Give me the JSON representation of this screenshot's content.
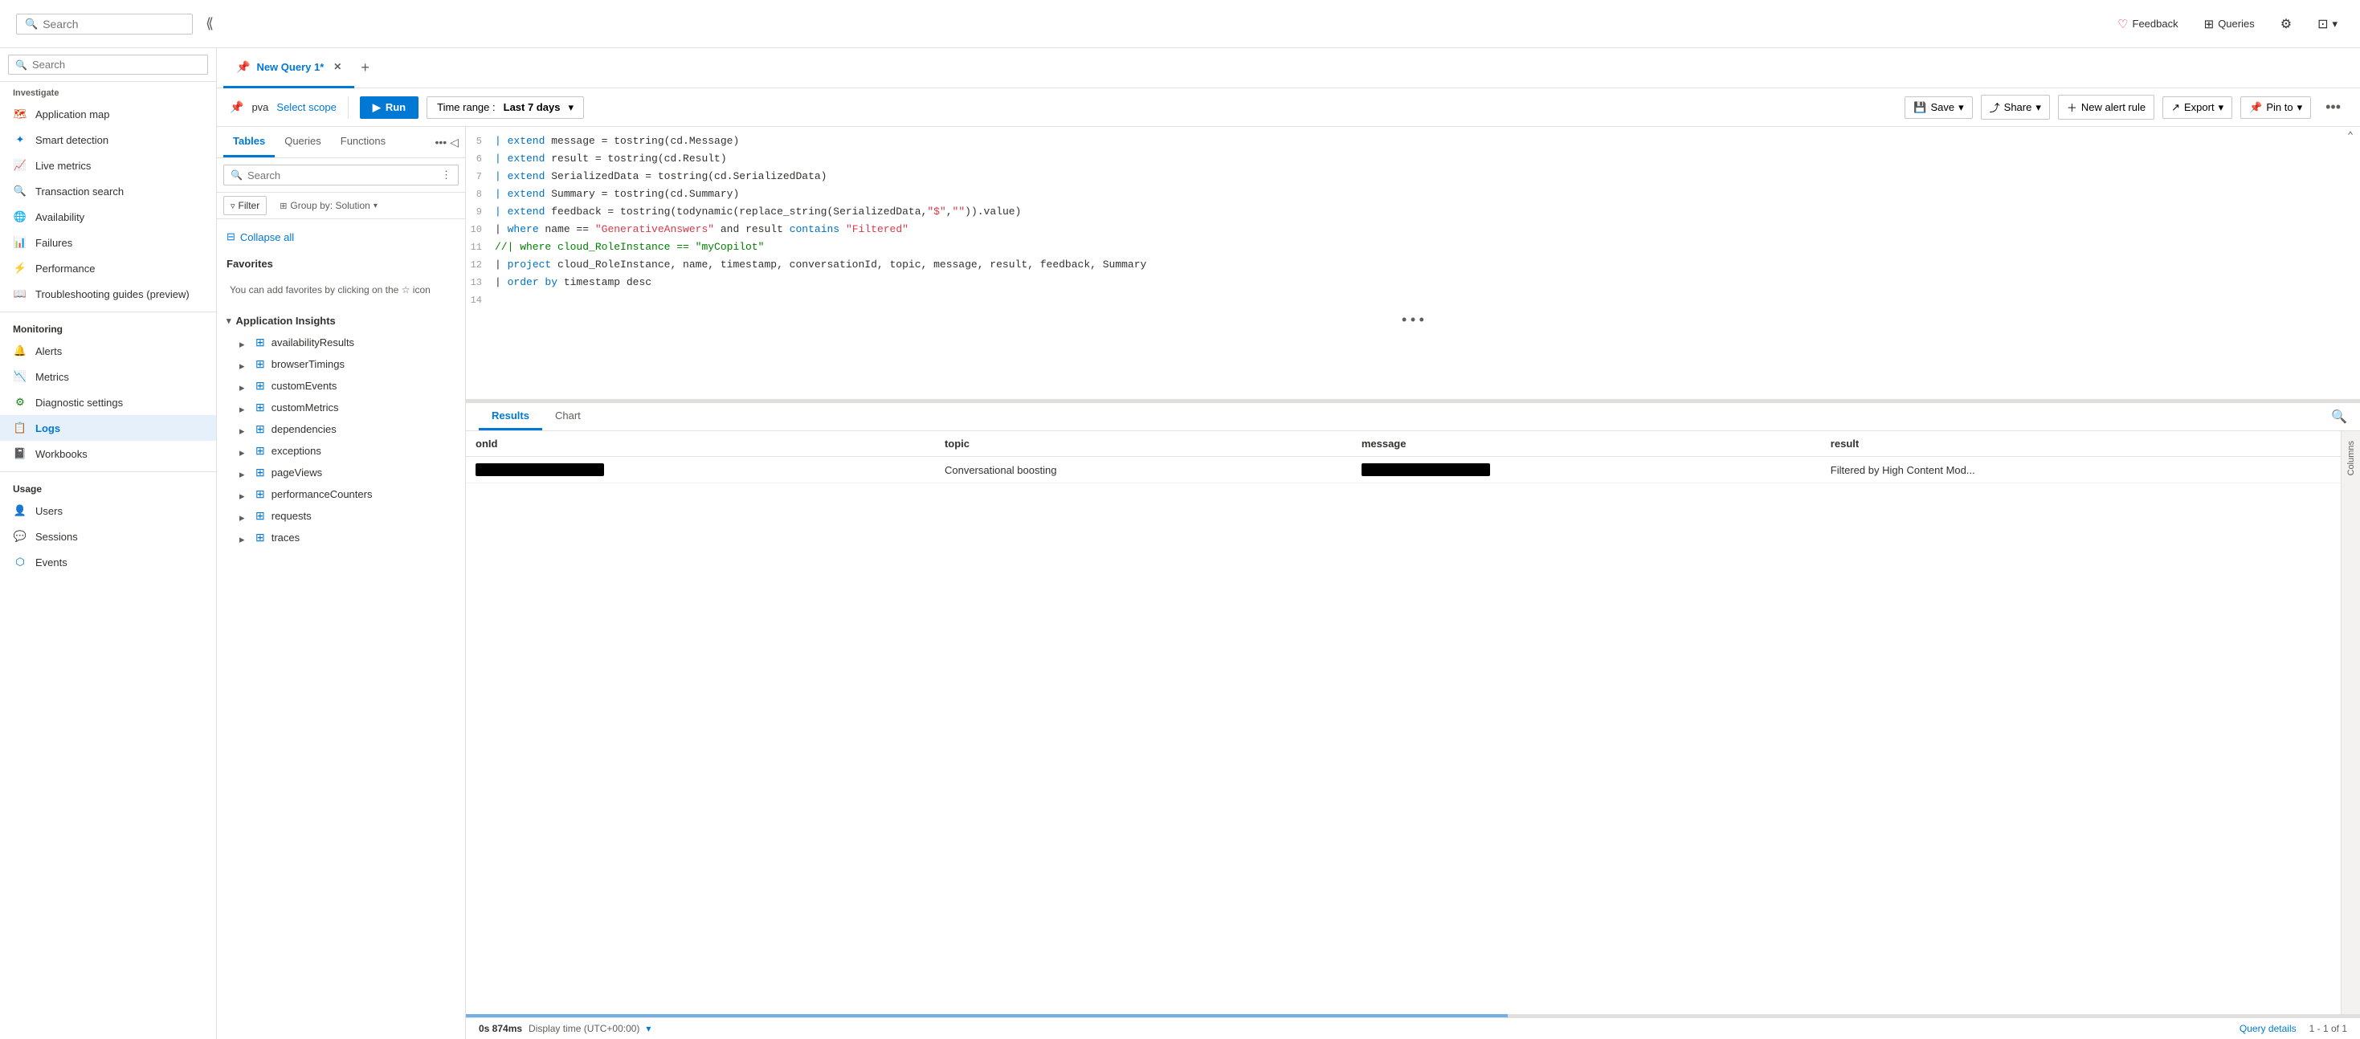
{
  "topbar": {
    "search_placeholder": "Search",
    "feedback_label": "Feedback",
    "queries_label": "Queries",
    "settings_tooltip": "Settings",
    "expand_tooltip": "Expand"
  },
  "sidebar": {
    "search_placeholder": "Search",
    "collapse_tooltip": "Collapse",
    "investigate_label": "Investigate",
    "items": [
      {
        "id": "application-map",
        "label": "Application map",
        "icon": "map",
        "color": "orange"
      },
      {
        "id": "smart-detection",
        "label": "Smart detection",
        "icon": "star",
        "color": "blue"
      },
      {
        "id": "live-metrics",
        "label": "Live metrics",
        "icon": "chart-line",
        "color": "green"
      },
      {
        "id": "transaction-search",
        "label": "Transaction search",
        "icon": "search-sidebar",
        "color": "blue"
      },
      {
        "id": "availability",
        "label": "Availability",
        "icon": "globe",
        "color": "blue"
      },
      {
        "id": "failures",
        "label": "Failures",
        "icon": "chart-bar",
        "color": "red"
      },
      {
        "id": "performance",
        "label": "Performance",
        "icon": "speed",
        "color": "blue"
      },
      {
        "id": "troubleshooting-guides",
        "label": "Troubleshooting guides (preview)",
        "icon": "book",
        "color": "blue"
      }
    ],
    "monitoring_label": "Monitoring",
    "monitoring_items": [
      {
        "id": "alerts",
        "label": "Alerts",
        "icon": "bell",
        "color": "green"
      },
      {
        "id": "metrics",
        "label": "Metrics",
        "icon": "chart-metrics",
        "color": "blue"
      },
      {
        "id": "diagnostic-settings",
        "label": "Diagnostic settings",
        "icon": "gear-sidebar",
        "color": "green"
      },
      {
        "id": "logs",
        "label": "Logs",
        "icon": "logs",
        "color": "blue",
        "active": true
      },
      {
        "id": "workbooks",
        "label": "Workbooks",
        "icon": "book-workbooks",
        "color": "blue"
      }
    ],
    "usage_label": "Usage",
    "usage_items": [
      {
        "id": "users",
        "label": "Users",
        "icon": "person",
        "color": "blue"
      },
      {
        "id": "sessions",
        "label": "Sessions",
        "icon": "session",
        "color": "blue"
      },
      {
        "id": "events",
        "label": "Events",
        "icon": "events",
        "color": "blue"
      }
    ]
  },
  "tabs": [
    {
      "id": "new-query-1",
      "label": "New Query 1*",
      "active": true,
      "closable": true
    }
  ],
  "add_tab_label": "+",
  "query_toolbar": {
    "scope_icon": "📌",
    "scope_text": "pva",
    "select_scope_label": "Select scope",
    "run_label": "Run",
    "time_range_label": "Time range :",
    "time_range_value": "Last 7 days",
    "save_label": "Save",
    "share_label": "Share",
    "new_alert_rule_label": "New alert rule",
    "export_label": "Export",
    "pin_to_label": "Pin to",
    "more_label": "..."
  },
  "middle_panel": {
    "tabs": [
      {
        "id": "tables",
        "label": "Tables",
        "active": true
      },
      {
        "id": "queries",
        "label": "Queries"
      },
      {
        "id": "functions",
        "label": "Functions"
      }
    ],
    "more_label": "...",
    "collapse_panel": "◁",
    "search_placeholder": "Search",
    "more_options": ":",
    "filter_label": "Filter",
    "group_by_label": "Group by: Solution",
    "collapse_all_label": "Collapse all",
    "favorites_section": "Favorites",
    "favorites_hint": "You can add favorites by clicking on the ☆ icon",
    "schema_section": "Application Insights",
    "tables": [
      "availabilityResults",
      "browserTimings",
      "customEvents",
      "customMetrics",
      "dependencies",
      "exceptions",
      "pageViews",
      "performanceCounters",
      "requests",
      "traces"
    ]
  },
  "editor": {
    "lines": [
      {
        "num": "5",
        "content": "| extend message = tostring(cd.Message)"
      },
      {
        "num": "6",
        "content": "| extend result = tostring(cd.Result)"
      },
      {
        "num": "7",
        "content": "| extend SerializedData = tostring(cd.SerializedData)"
      },
      {
        "num": "8",
        "content": "| extend Summary = tostring(cd.Summary)"
      },
      {
        "num": "9",
        "content": "| extend feedback = tostring(todynamic(replace_string(SerializedData,\"$\",\"\")).value)"
      },
      {
        "num": "10",
        "content_parts": [
          {
            "text": "| ",
            "type": "normal"
          },
          {
            "text": "where",
            "type": "kw-blue"
          },
          {
            "text": " name == ",
            "type": "normal"
          },
          {
            "text": "\"GenerativeAnswers\"",
            "type": "str-red"
          },
          {
            "text": " and result ",
            "type": "normal"
          },
          {
            "text": "contains",
            "type": "kw-blue"
          },
          {
            "text": " ",
            "type": "normal"
          },
          {
            "text": "\"Filtered\"",
            "type": "str-red"
          }
        ]
      },
      {
        "num": "11",
        "content": "//| where cloud_RoleInstance == \"myCopilot\"",
        "type": "comment"
      },
      {
        "num": "12",
        "content": "| project cloud_RoleInstance, name, timestamp, conversationId, topic, message, result, feedback, Summary"
      },
      {
        "num": "13",
        "content": "| order by timestamp desc"
      },
      {
        "num": "14",
        "content": ""
      }
    ],
    "dots": "..."
  },
  "results": {
    "tabs": [
      {
        "id": "results",
        "label": "Results",
        "active": true
      },
      {
        "id": "chart",
        "label": "Chart"
      }
    ],
    "columns": [
      {
        "id": "onId",
        "label": "onId"
      },
      {
        "id": "topic",
        "label": "topic"
      },
      {
        "id": "message",
        "label": "message"
      },
      {
        "id": "result",
        "label": "result"
      }
    ],
    "rows": [
      {
        "onId": "MASKED",
        "topic": "Conversational boosting",
        "message": "MASKED",
        "result": "Filtered by High Content Mod..."
      }
    ],
    "status": {
      "timing": "0s 874ms",
      "display_time_label": "Display time (UTC+00:00)",
      "query_details_label": "Query details",
      "count_label": "1 - 1 of 1"
    },
    "columns_label": "Columns"
  }
}
